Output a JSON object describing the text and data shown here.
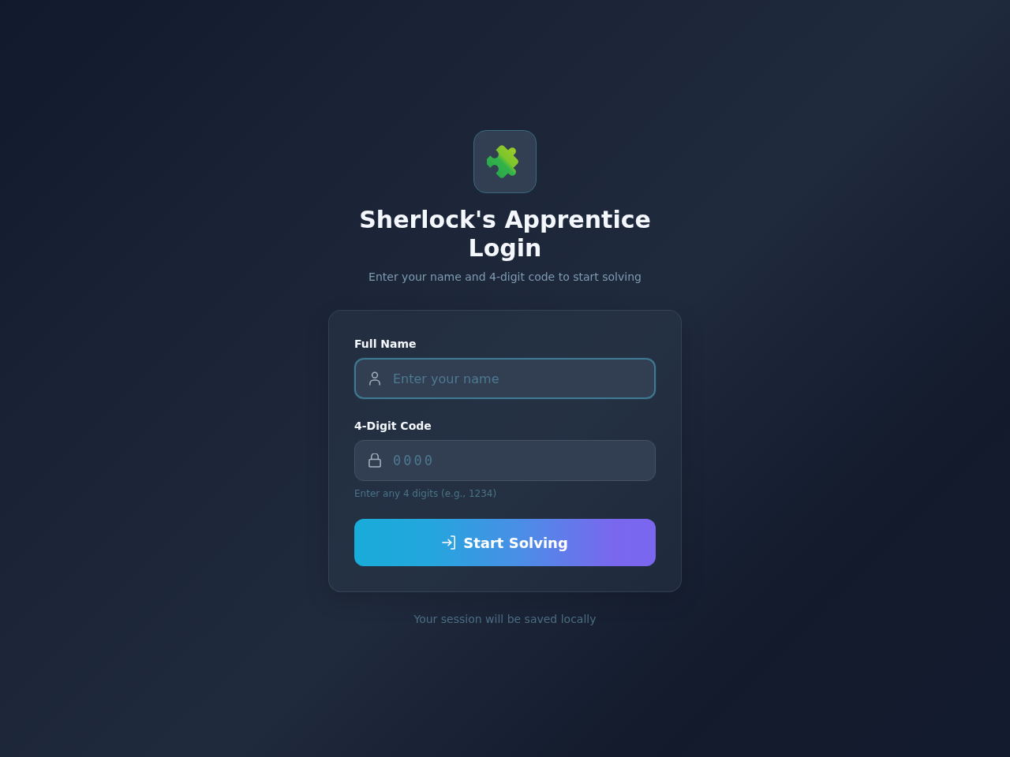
{
  "header": {
    "title": "Sherlock's Apprentice Login",
    "subtitle": "Enter your name and 4-digit code to start solving"
  },
  "form": {
    "fields": [
      {
        "kind": "text",
        "label": "Full Name",
        "placeholder": "Enter your name",
        "focused": true
      },
      {
        "kind": "code",
        "label": "4-Digit Code",
        "placeholder": "0000",
        "focused": false,
        "hint": "Enter any 4 digits (e.g., 1234)"
      }
    ],
    "submit_button": {
      "label": "Start Solving"
    }
  },
  "footer_note": "Your session will be saved locally"
}
